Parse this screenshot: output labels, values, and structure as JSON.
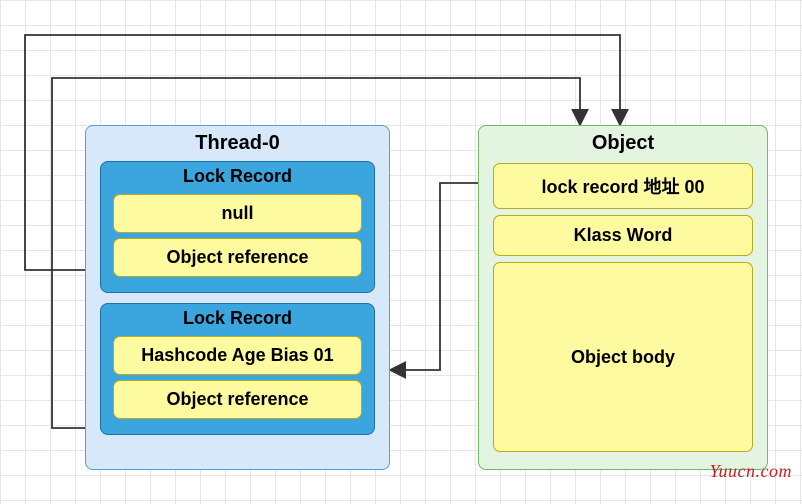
{
  "thread": {
    "title": "Thread-0",
    "lockRecords": [
      {
        "title": "Lock Record",
        "slot1": "null",
        "slot2": "Object reference"
      },
      {
        "title": "Lock Record",
        "slot1": "Hashcode Age Bias 01",
        "slot2": "Object reference"
      }
    ]
  },
  "object": {
    "title": "Object",
    "markWord": "lock record 地址 00",
    "klassWord": "Klass Word",
    "body": "Object body"
  },
  "watermark": "Yuucn.com",
  "arrows": {
    "desc": [
      "Thread-0.LockRecord[0].ObjectReference -> Object (top path)",
      "Thread-0.LockRecord[1].ObjectReference -> Object (inner path)",
      "Object.markWord (lock record 地址 00) -> Thread-0.LockRecord[1] (bottom area)"
    ]
  }
}
